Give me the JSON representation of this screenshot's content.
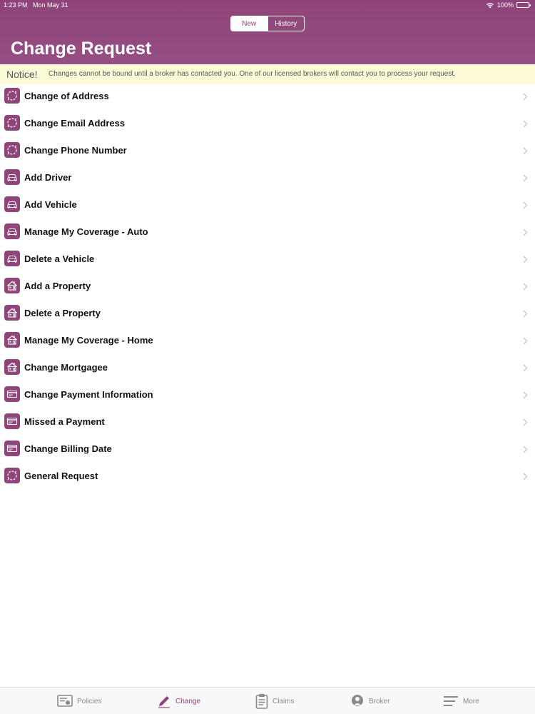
{
  "status_bar": {
    "time": "1:23 PM",
    "date": "Mon May 31",
    "battery": "100%",
    "battery_level": 1.0
  },
  "segments": {
    "new_label": "New",
    "history_label": "History",
    "selected": "New"
  },
  "page_title": "Change Request",
  "notice": {
    "label": "Notice!",
    "text": "Changes cannot be bound until a broker has contacted you. One of our licensed brokers will contact you to process your request."
  },
  "colors": {
    "brand": "#8e4479",
    "notice_bg": "#fdfbd8",
    "icon_bg": "#8f4579"
  },
  "items": [
    {
      "label": "Change of Address",
      "icon": "refresh-icon"
    },
    {
      "label": "Change Email Address",
      "icon": "refresh-icon"
    },
    {
      "label": "Change Phone Number",
      "icon": "refresh-icon"
    },
    {
      "label": "Add Driver",
      "icon": "car-icon"
    },
    {
      "label": "Add Vehicle",
      "icon": "car-icon"
    },
    {
      "label": "Manage My Coverage - Auto",
      "icon": "car-icon"
    },
    {
      "label": "Delete a Vehicle",
      "icon": "car-icon"
    },
    {
      "label": "Add a Property",
      "icon": "house-icon"
    },
    {
      "label": "Delete a Property",
      "icon": "house-icon"
    },
    {
      "label": "Manage My Coverage - Home",
      "icon": "house-icon"
    },
    {
      "label": "Change Mortgagee",
      "icon": "house-icon"
    },
    {
      "label": "Change Payment Information",
      "icon": "credit-card-icon"
    },
    {
      "label": "Missed a Payment",
      "icon": "credit-card-icon"
    },
    {
      "label": "Change Billing Date",
      "icon": "credit-card-icon"
    },
    {
      "label": "General Request",
      "icon": "refresh-icon"
    }
  ],
  "tabs": [
    {
      "label": "Policies",
      "icon": "policies-icon"
    },
    {
      "label": "Change",
      "icon": "pencil-icon",
      "active": true
    },
    {
      "label": "Claims",
      "icon": "clipboard-icon"
    },
    {
      "label": "Broker",
      "icon": "broker-icon"
    },
    {
      "label": "More",
      "icon": "menu-icon"
    }
  ]
}
